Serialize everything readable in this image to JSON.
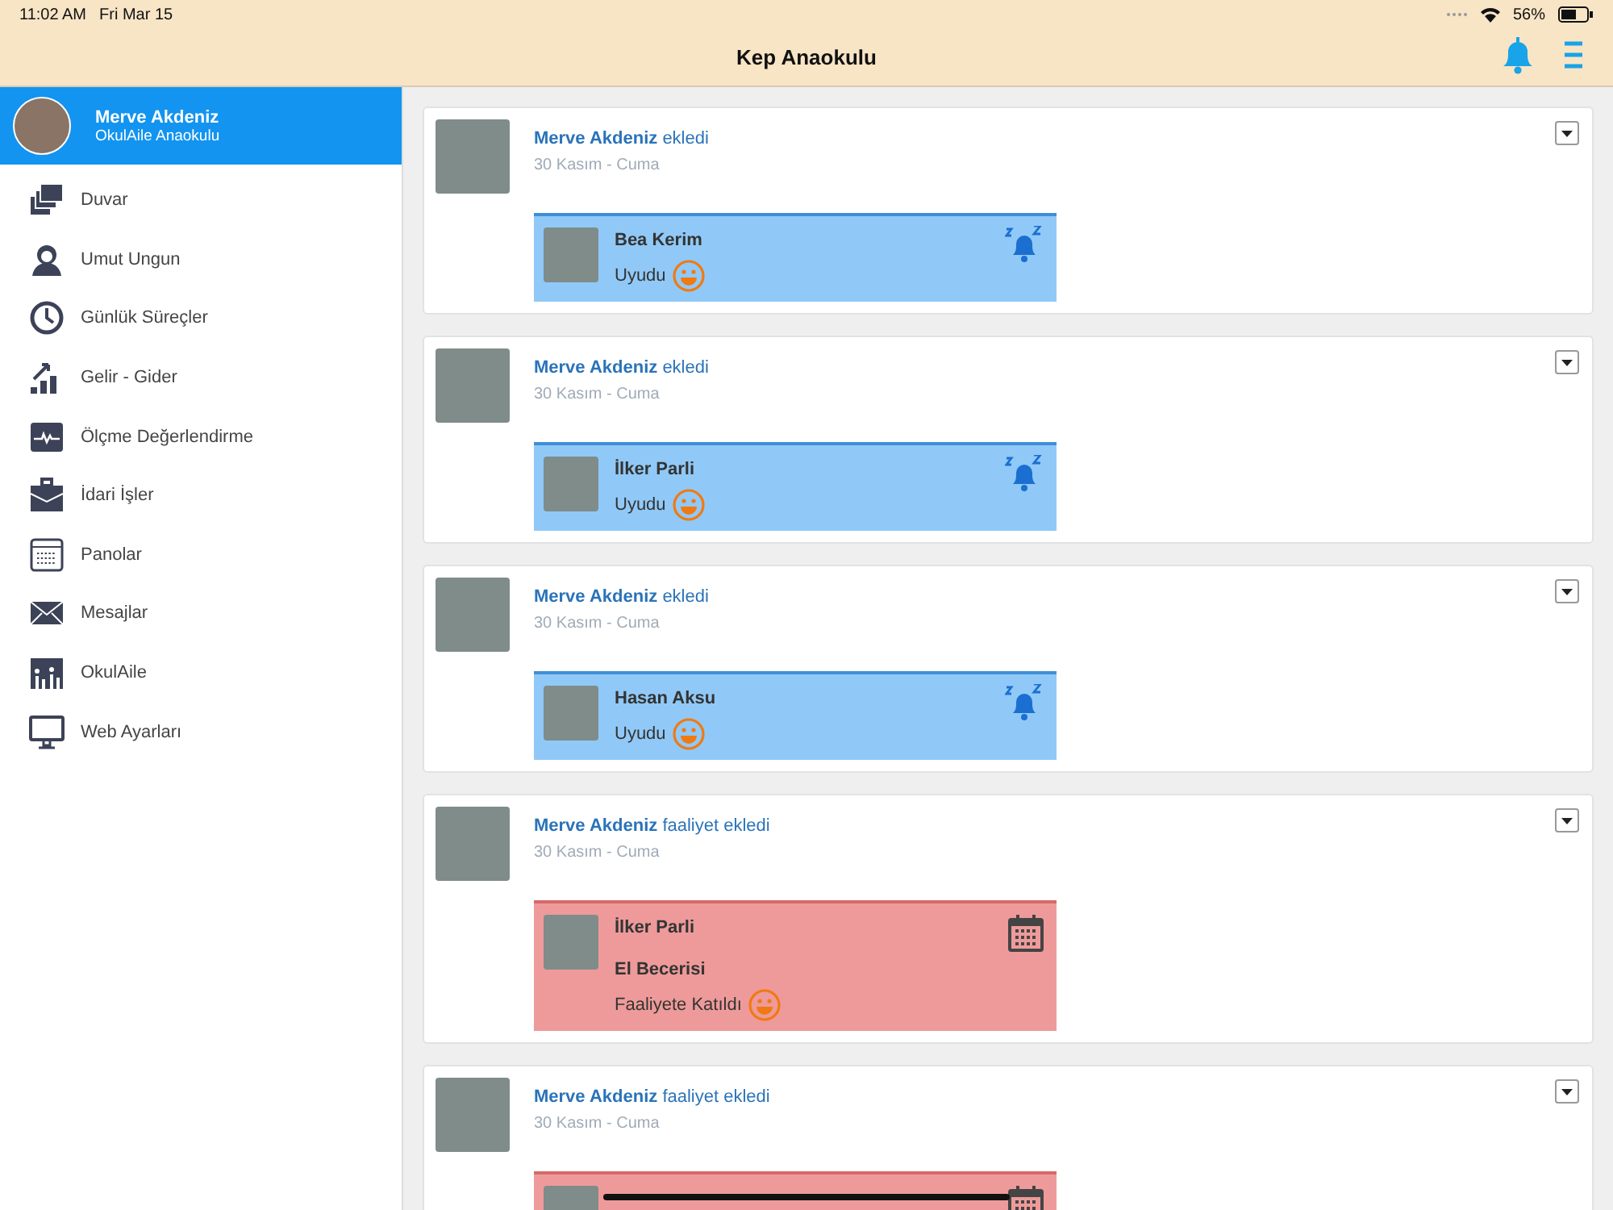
{
  "status_bar": {
    "time": "11:02 AM",
    "date": "Fri Mar 15",
    "battery": "56%"
  },
  "header": {
    "title": "Kep Anaokulu"
  },
  "profile": {
    "name": "Merve Akdeniz",
    "school": "OkulAile Anaokulu"
  },
  "sidebar": {
    "items": [
      {
        "label": "Duvar",
        "kind": "wall"
      },
      {
        "label": "Umut Ungun",
        "kind": "child"
      },
      {
        "label": "Günlük Süreçler",
        "kind": "clock"
      },
      {
        "label": "Gelir - Gider",
        "kind": "chart"
      },
      {
        "label": "Ölçme Değerlendirme",
        "kind": "monitor-wave"
      },
      {
        "label": "İdari İşler",
        "kind": "briefcase"
      },
      {
        "label": "Panolar",
        "kind": "board"
      },
      {
        "label": "Mesajlar",
        "kind": "mail"
      },
      {
        "label": "OkulAile",
        "kind": "family"
      },
      {
        "label": "Web Ayarları",
        "kind": "screen"
      }
    ]
  },
  "posts": [
    {
      "author": "Merve Akdeniz",
      "action": "ekledi",
      "date": "30 Kasım - Cuma",
      "entry": {
        "kind": "sleep",
        "child": "Bea Kerim",
        "status": "Uyudu"
      }
    },
    {
      "author": "Merve Akdeniz",
      "action": "ekledi",
      "date": "30 Kasım - Cuma",
      "entry": {
        "kind": "sleep",
        "child": "İlker Parli",
        "status": "Uyudu"
      }
    },
    {
      "author": "Merve Akdeniz",
      "action": "ekledi",
      "date": "30 Kasım - Cuma",
      "entry": {
        "kind": "sleep",
        "child": "Hasan Aksu",
        "status": "Uyudu"
      }
    },
    {
      "author": "Merve Akdeniz",
      "action": "faaliyet ekledi",
      "date": "30 Kasım - Cuma",
      "entry": {
        "kind": "activity",
        "child": "İlker Parli",
        "activity": "El Becerisi",
        "status": "Faaliyete Katıldı"
      }
    },
    {
      "author": "Merve Akdeniz",
      "action": "faaliyet ekledi",
      "date": "30 Kasım - Cuma",
      "entry": {
        "kind": "activity"
      }
    }
  ]
}
